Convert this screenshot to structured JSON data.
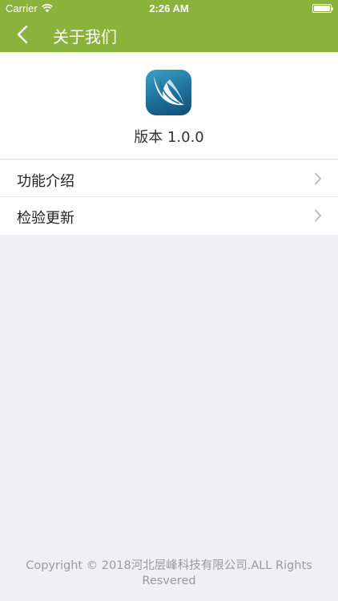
{
  "status_bar": {
    "carrier": "Carrier",
    "time": "2:26 AM",
    "icons": [
      "wifi-icon",
      "battery-icon"
    ]
  },
  "nav_bar": {
    "title": "关于我们",
    "back_icon": "chevron-left-icon"
  },
  "about": {
    "logo_icon": "app-logo",
    "version": "版本 1.0.0"
  },
  "menu": {
    "items": [
      {
        "label": "功能介绍",
        "icon": "chevron-right-icon"
      },
      {
        "label": "检验更新",
        "icon": "chevron-right-icon"
      }
    ]
  },
  "footer": {
    "copyright": "Copyright © 2018河北层峰科技有限公司.ALL Rights Resvered"
  },
  "colors": {
    "brand_green": "#8ab33c",
    "background": "#efeff4",
    "logo_blue": "#1e6f99"
  }
}
